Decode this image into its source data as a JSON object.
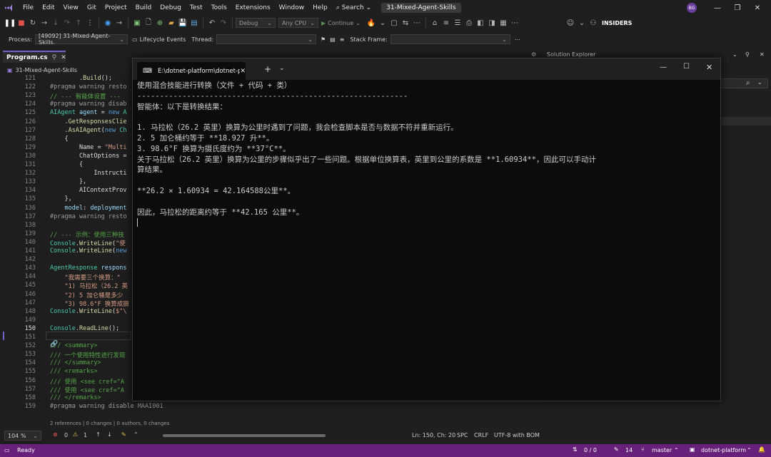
{
  "menubar": {
    "items": [
      "File",
      "Edit",
      "View",
      "Git",
      "Project",
      "Build",
      "Debug",
      "Test",
      "Tools",
      "Extensions",
      "Window",
      "Help"
    ],
    "search_label": "Search",
    "project_name": "31-Mixed-Agent-Skills",
    "avatar_initials": "BG",
    "insiders_label": "INSIDERS"
  },
  "toolbar": {
    "config": "Debug",
    "platform": "Any CPU",
    "continue_label": "Continue"
  },
  "debugbar": {
    "process_label": "Process:",
    "process_value": "[49092] 31-Mixed-Agent-Skills.",
    "lifecycle_label": "Lifecycle Events",
    "thread_label": "Thread:",
    "stackframe_label": "Stack Frame:"
  },
  "editor": {
    "tab_label": "Program.cs",
    "nav_project": "31-Mixed-Agent-Skills",
    "lines": [
      {
        "n": "121",
        "html": "        .<span class='c-me'>Build</span>();"
      },
      {
        "n": "122",
        "html": "<span class='c-pp'>#pragma warning resto</span>"
      },
      {
        "n": "123",
        "html": "<span class='c-cm'>// --- 智能体设置 ---</span>"
      },
      {
        "n": "124",
        "html": "<span class='c-pp'>#pragma warning disab</span>"
      },
      {
        "n": "125",
        "html": "<span class='c-ty'>AIAgent</span> <span class='c-pr'>agent</span> = <span class='c-kw'>new</span> <span class='c-ty'>A</span>"
      },
      {
        "n": "126",
        "html": "    .<span class='c-me'>GetResponsesClie</span>"
      },
      {
        "n": "127",
        "html": "    .<span class='c-me'>AsAIAgent</span>(<span class='c-kw'>new</span> <span class='c-ty'>Ch</span>"
      },
      {
        "n": "128",
        "html": "    {"
      },
      {
        "n": "129",
        "html": "        Name = <span class='c-st'>\"Multi</span>"
      },
      {
        "n": "130",
        "html": "        ChatOptions ="
      },
      {
        "n": "131",
        "html": "        {"
      },
      {
        "n": "132",
        "html": "            Instructi"
      },
      {
        "n": "133",
        "html": "        },"
      },
      {
        "n": "134",
        "html": "        AIContextProv"
      },
      {
        "n": "135",
        "html": "    },"
      },
      {
        "n": "136",
        "html": "    <span class='c-pr'>model</span>: <span class='c-pr'>deployment</span>"
      },
      {
        "n": "137",
        "html": "<span class='c-pp'>#pragma warning resto</span>"
      },
      {
        "n": "138",
        "html": ""
      },
      {
        "n": "139",
        "html": "<span class='c-cm'>// --- 示例：使用三种技</span>"
      },
      {
        "n": "140",
        "html": "<span class='c-ty'>Console</span>.<span class='c-me'>WriteLine</span>(<span class='c-st'>\"使</span>"
      },
      {
        "n": "141",
        "html": "<span class='c-ty'>Console</span>.<span class='c-me'>WriteLine</span>(<span class='c-kw'>new</span>"
      },
      {
        "n": "142",
        "html": ""
      },
      {
        "n": "143",
        "html": "<span class='c-ty'>AgentResponse</span> <span class='c-pr'>respons</span>"
      },
      {
        "n": "144",
        "html": "    <span class='c-st'>\"我需要三个换算：\" </span>"
      },
      {
        "n": "145",
        "html": "    <span class='c-st'>\"1) 马拉松（26.2 英</span>"
      },
      {
        "n": "146",
        "html": "    <span class='c-st'>\"2) 5 加仑桶是多少</span>"
      },
      {
        "n": "147",
        "html": "    <span class='c-st'>\"3) 98.6°F 换算成摄</span>"
      },
      {
        "n": "148",
        "html": "<span class='c-ty'>Console</span>.<span class='c-me'>WriteLine</span>(<span class='c-st'>$\"\\</span>"
      },
      {
        "n": "149",
        "html": ""
      },
      {
        "n": "150",
        "html": "<span class='c-ty'>Console</span>.<span class='c-me'>ReadLine</span>();"
      },
      {
        "n": "151",
        "html": ""
      },
      {
        "n": "152",
        "html": "<span class='c-cm'>/// &lt;summary&gt;</span>"
      },
      {
        "n": "153",
        "html": "<span class='c-cm'>/// 一个使用特性进行发现</span>"
      },
      {
        "n": "154",
        "html": "<span class='c-cm'>/// &lt;/summary&gt;</span>"
      },
      {
        "n": "155",
        "html": "<span class='c-cm'>/// &lt;remarks&gt;</span>"
      },
      {
        "n": "156",
        "html": "<span class='c-cm'>/// 使用 &lt;see cref=\"A</span>"
      },
      {
        "n": "157",
        "html": "<span class='c-cm'>/// 使用 &lt;see cref=\"A</span>"
      },
      {
        "n": "158",
        "html": "<span class='c-cm'>/// &lt;/remarks&gt;</span>"
      },
      {
        "n": "159",
        "html": "<span class='c-pp'>#pragma warning disable MAAI001</span>"
      }
    ],
    "codelens": "2 references | 0 changes | 0 authors, 0 changes"
  },
  "editor_status": {
    "zoom": "104 %",
    "errors": "0",
    "warnings": "1",
    "position": "Ln: 150, Ch: 20",
    "spc": "SPC",
    "crlf": "CRLF",
    "encoding": "UTF-8 with BOM"
  },
  "solution_explorer": {
    "title": "Solution Explorer"
  },
  "terminal": {
    "tab_title": "E:\\dotnet-platform\\dotnet-pl",
    "lines": [
      "使用混合技能进行转换（文件 + 代码 + 类）",
      "------------------------------------------------------------",
      "智能体：以下是转换结果：",
      "",
      "1. 马拉松（26.2 英里）换算为公里时遇到了问题，我会检查脚本是否与数据不符并重新运行。",
      "2. 5 加仑桶约等于 **18.927 升**。",
      "3. 98.6°F 换算为摄氏度约为 **37°C**。",
      "关于马拉松（26.2 英里）换算为公里的步骤似乎出了一些问题。根据单位换算表，英里到公里的系数是 **1.60934**，因此可以手动计",
      "算结果。",
      "",
      "**26.2 × 1.60934 = 42.164588公里**。",
      "",
      "因此，马拉松的距离约等于 **42.165 公里**。"
    ]
  },
  "statusbar": {
    "ready": "Ready",
    "sync": "0 / 0",
    "edits": "14",
    "branch": "master",
    "repo": "dotnet-platform"
  }
}
